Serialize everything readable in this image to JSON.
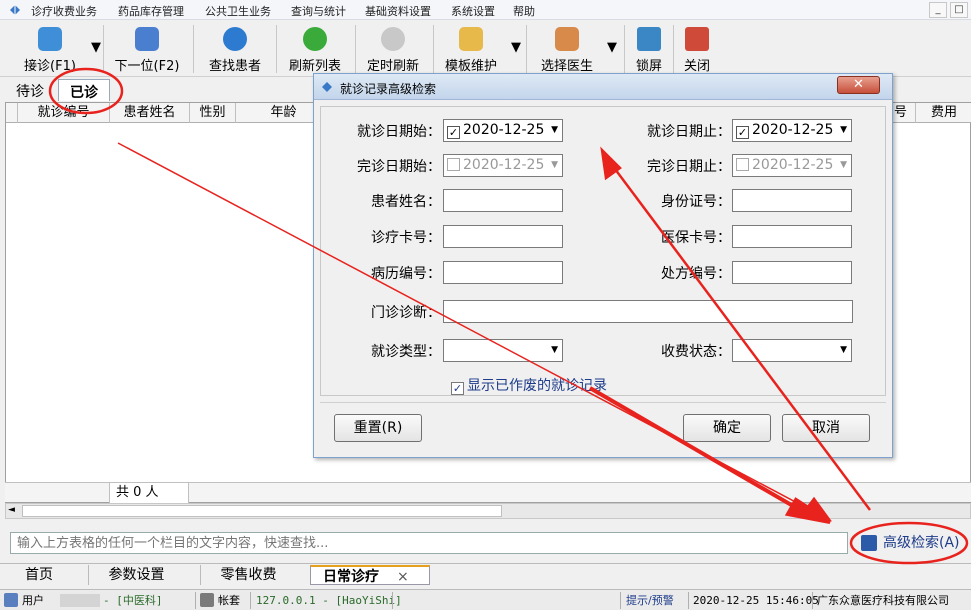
{
  "menu": {
    "items": [
      "诊疗收费业务",
      "药品库存管理",
      "公共卫生业务",
      "查询与统计",
      "基础资料设置",
      "系统设置",
      "帮助"
    ],
    "window_controls": [
      "_",
      "□"
    ]
  },
  "toolbar": {
    "buttons": [
      {
        "label": "接诊(F1)",
        "icon": "add-patient-icon"
      },
      {
        "label": "下一位(F2)",
        "icon": "next-patient-icon"
      },
      {
        "label": "查找患者",
        "icon": "search-icon"
      },
      {
        "label": "刷新列表",
        "icon": "refresh-icon"
      },
      {
        "label": "定时刷新",
        "icon": "eye-icon"
      },
      {
        "label": "模板维护",
        "icon": "template-icon"
      },
      {
        "label": "选择医生",
        "icon": "doctor-icon"
      },
      {
        "label": "锁屏",
        "icon": "monitor-icon"
      },
      {
        "label": "关闭",
        "icon": "exit-icon"
      }
    ]
  },
  "top_tabs": [
    "待诊",
    "已诊"
  ],
  "grid": {
    "columns": [
      "就诊编号",
      "患者姓名",
      "性别",
      "年龄",
      "费用"
    ],
    "hidden_partial_col": "号",
    "footer_count": "共 0 人"
  },
  "search": {
    "placeholder": "输入上方表格的任何一个栏目的文字内容，快速查找...",
    "advanced_label": "高级检索(A)"
  },
  "bottom_tabs": [
    "首页",
    "参数设置",
    "零售收费",
    "日常诊疗"
  ],
  "bottom_tab_close": "×",
  "status": {
    "user_label": "用户",
    "dept": "- [中医科]",
    "account_label": "帐套",
    "server": "127.0.0.1 - [HaoYiShi]",
    "hint": "提示/预警",
    "datetime": "2020-12-25 15:46:05",
    "company": "广东众意医疗科技有限公司"
  },
  "dialog": {
    "title": "就诊记录高级检索",
    "close": "✕",
    "fields": {
      "visit_start_label": "就诊日期始：",
      "visit_start_value": "2020-12-25",
      "visit_start_checked": true,
      "visit_end_label": "就诊日期止：",
      "visit_end_value": "2020-12-25",
      "visit_end_checked": true,
      "done_start_label": "完诊日期始：",
      "done_start_value": "2020-12-25",
      "done_start_checked": false,
      "done_end_label": "完诊日期止：",
      "done_end_value": "2020-12-25",
      "done_end_checked": false,
      "patient_name_label": "患者姓名：",
      "id_card_label": "身份证号：",
      "clinic_card_label": "诊疗卡号：",
      "insurance_card_label": "医保卡号：",
      "record_no_label": "病历编号：",
      "prescription_no_label": "处方编号：",
      "diagnosis_label": "门诊诊断：",
      "visit_type_label": "就诊类型：",
      "fee_status_label": "收费状态："
    },
    "show_voided_label": "显示已作废的就诊记录",
    "show_voided_checked": true,
    "reset_label": "重置(R)",
    "ok_label": "确定",
    "cancel_label": "取消"
  },
  "colors": {
    "annotation": "#e8231e",
    "link_blue": "#1e3c8a",
    "dialog_title": "#c3d5ec"
  }
}
